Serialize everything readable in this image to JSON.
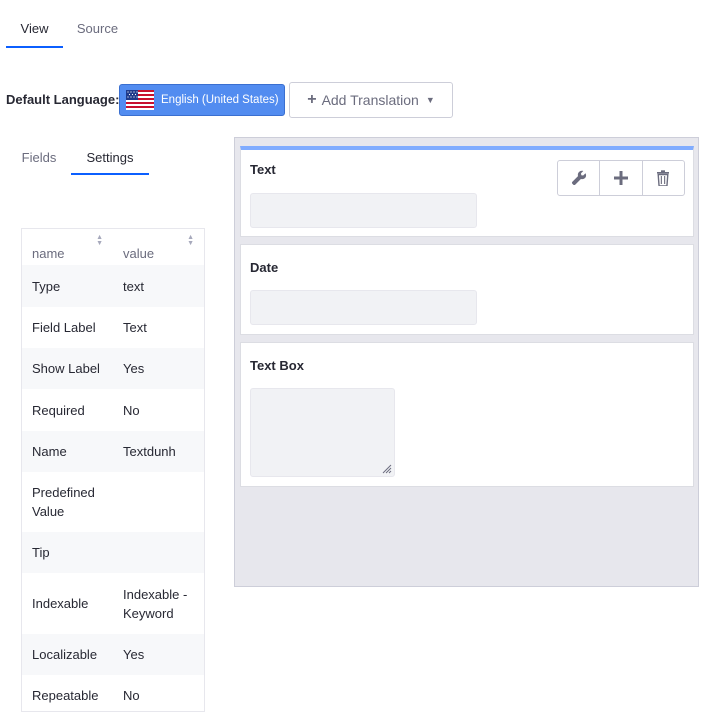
{
  "top_tabs": [
    {
      "label": "View",
      "active": true
    },
    {
      "label": "Source",
      "active": false
    }
  ],
  "default_language": {
    "label": "Default Language:",
    "selected": "English (United States)",
    "flag_icon": "us-flag-icon"
  },
  "add_translation": {
    "label": "Add Translation",
    "icon": "plus-icon"
  },
  "side_tabs": [
    {
      "label": "Fields",
      "active": false
    },
    {
      "label": "Settings",
      "active": true
    }
  ],
  "settings_table": {
    "columns": [
      "name",
      "value"
    ],
    "rows": [
      {
        "name": "Type",
        "value": "text"
      },
      {
        "name": "Field Label",
        "value": "Text"
      },
      {
        "name": "Show Label",
        "value": "Yes"
      },
      {
        "name": "Required",
        "value": "No"
      },
      {
        "name": "Name",
        "value": "Textdunh"
      },
      {
        "name": "Predefined Value",
        "value": ""
      },
      {
        "name": "Tip",
        "value": ""
      },
      {
        "name": "Indexable",
        "value": "Indexable - Keyword"
      },
      {
        "name": "Localizable",
        "value": "Yes"
      },
      {
        "name": "Repeatable",
        "value": "No"
      }
    ]
  },
  "form_fields": [
    {
      "label": "Text",
      "type": "text",
      "selected": true
    },
    {
      "label": "Date",
      "type": "date",
      "selected": false
    },
    {
      "label": "Text Box",
      "type": "textarea",
      "selected": false
    }
  ],
  "field_toolbar": [
    "wrench-icon",
    "plus-icon",
    "trash-icon"
  ],
  "colors": {
    "accent": "#0b5fff",
    "language_button": "#528cf0",
    "selected_bar": "#80acff",
    "canvas_bg": "#e7e7ed"
  }
}
